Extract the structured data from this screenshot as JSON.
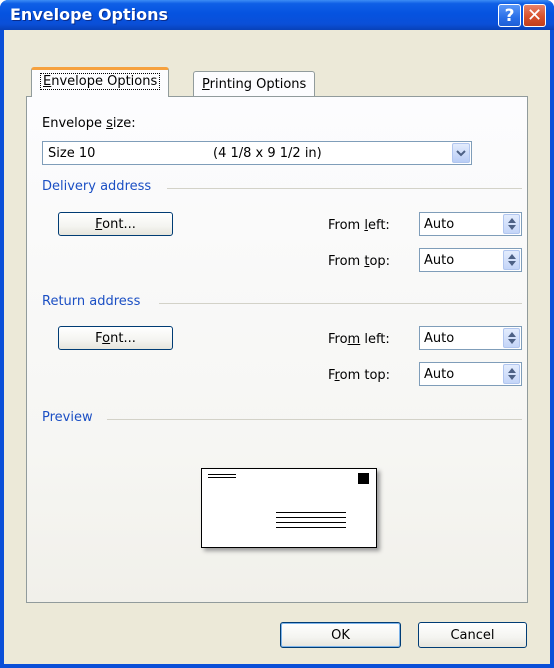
{
  "window": {
    "title": "Envelope Options",
    "help_glyph": "?",
    "close_glyph": "✕"
  },
  "tabs": [
    {
      "label": "Envelope Options",
      "accel": "E",
      "active": true
    },
    {
      "label": "Printing Options",
      "accel": "P",
      "active": false
    }
  ],
  "envelope_size": {
    "label": "Envelope size:",
    "accel": "s",
    "value": "Size 10",
    "description": "(4 1/8 x 9 1/2 in)"
  },
  "delivery": {
    "group_label": "Delivery address",
    "font_button": "Font...",
    "from_left_label": "From left:",
    "from_left_value": "Auto",
    "from_top_label": "From top:",
    "from_top_value": "Auto"
  },
  "return": {
    "group_label": "Return address",
    "font_button": "Font...",
    "from_left_label": "From left:",
    "from_left_value": "Auto",
    "from_top_label": "From top:",
    "from_top_value": "Auto"
  },
  "preview": {
    "group_label": "Preview"
  },
  "footer": {
    "ok_label": "OK",
    "cancel_label": "Cancel"
  },
  "colors": {
    "title_bar": "#0a4fd8",
    "group_label": "#1b4fc4",
    "active_tab_accent": "#f6a13e",
    "client_bg": "#ece9d8"
  },
  "icons": {
    "help": "help-icon",
    "close": "close-icon",
    "dropdown": "chevron-down-icon",
    "spinner": "spinner-arrows-icon"
  }
}
